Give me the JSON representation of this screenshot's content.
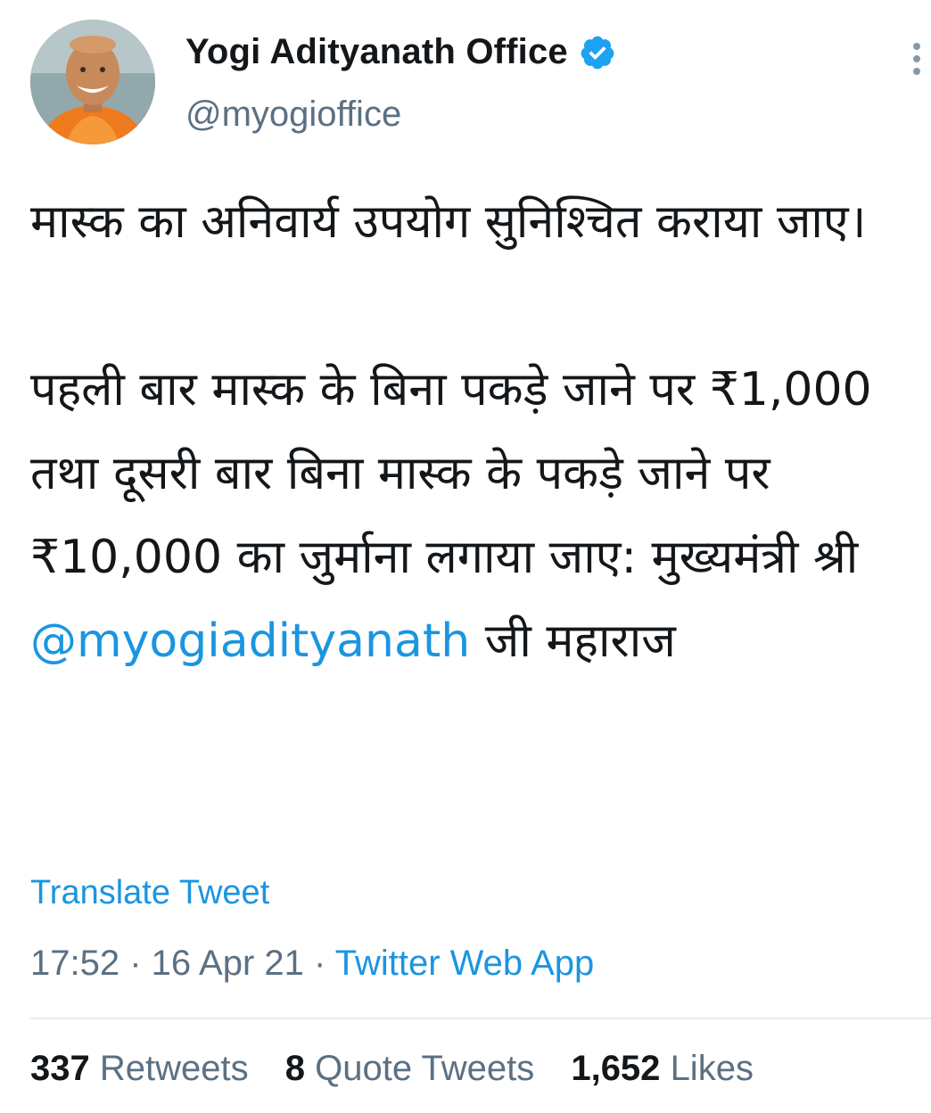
{
  "tweet": {
    "author": {
      "display_name": "Yogi Adityanath Office",
      "handle": "@myogioffice",
      "verified": true
    },
    "text_part1": "मास्क का अनिवार्य उपयोग सुनिश्चित कराया जाए।\n\nपहली बार मास्क के बिना पकड़े जाने पर ₹1,000 तथा दूसरी बार बिना मास्क के पकड़े जाने पर ₹10,000 का जुर्माना लगाया जाए: मुख्यमंत्री श्री ",
    "mention": "@myogiadityanath",
    "text_part2": " जी महाराज",
    "translate_label": "Translate Tweet",
    "time": "17:52",
    "separator": " · ",
    "date": "16 Apr 21",
    "source": "Twitter Web App",
    "stats": {
      "retweets_count": "337",
      "retweets_label": "Retweets",
      "quotes_count": "8",
      "quotes_label": "Quote Tweets",
      "likes_count": "1,652",
      "likes_label": "Likes"
    }
  },
  "icons": {
    "verified": "verified-badge-icon",
    "more": "more-options-icon"
  },
  "colors": {
    "link": "#1b95e0",
    "secondary_text": "#5b7083",
    "primary_text": "#14171a",
    "divider": "#e6ecf0",
    "verified_badge": "#1da1f2"
  }
}
